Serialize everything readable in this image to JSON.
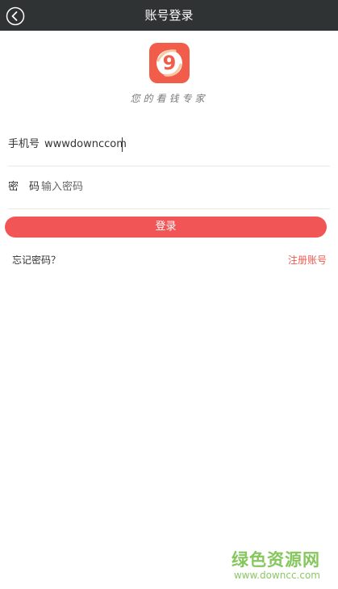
{
  "header": {
    "title": "账号登录",
    "back_icon": "back-arrow-icon"
  },
  "logo": {
    "glyph": "9",
    "brand_color": "#f25c4b"
  },
  "slogan": "您的看钱专家",
  "form": {
    "phone_label": "手机号",
    "phone_value": "wwwdownccom",
    "password_label": "密　码",
    "password_placeholder": "输入密码"
  },
  "login_button": {
    "label": "登录",
    "color": "#f25555"
  },
  "links": {
    "forgot": "忘记密码？",
    "register": "注册账号"
  },
  "watermark": {
    "title": "绿色资源网",
    "url": "www.downcc.com",
    "color": "#86c75d"
  }
}
